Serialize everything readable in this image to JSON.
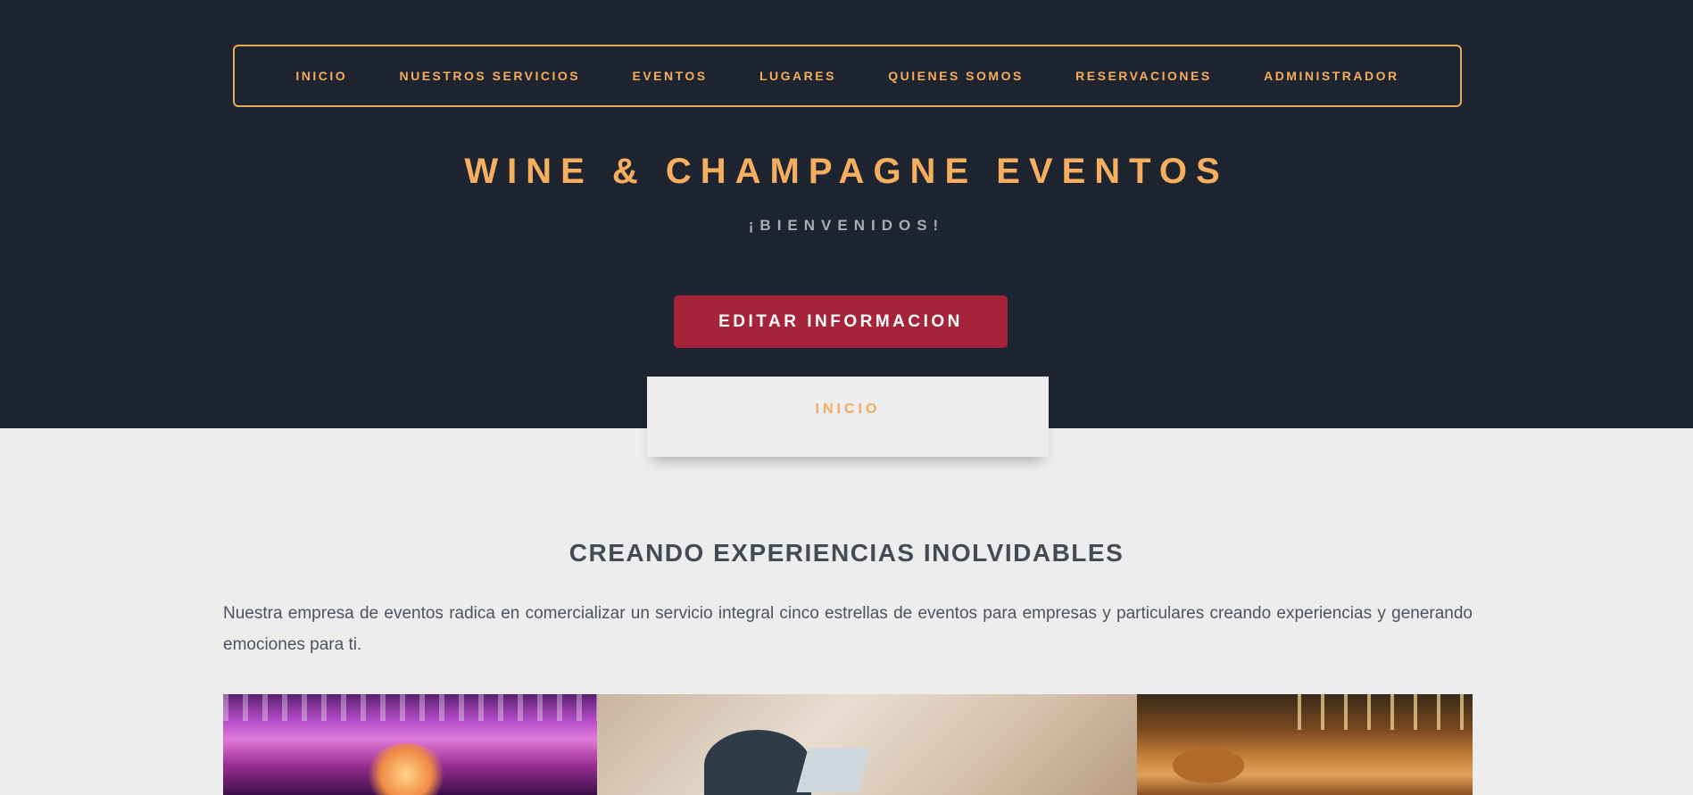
{
  "nav": {
    "items": [
      {
        "label": "INICIO"
      },
      {
        "label": "NUESTROS SERVICIOS"
      },
      {
        "label": "EVENTOS"
      },
      {
        "label": "LUGARES"
      },
      {
        "label": "QUIENES SOMOS"
      },
      {
        "label": "RESERVACIONES"
      },
      {
        "label": "ADMINISTRADOR"
      }
    ]
  },
  "hero": {
    "title": "WINE & CHAMPAGNE EVENTOS",
    "welcome": "¡BIENVENIDOS!",
    "edit_button_label": "EDITAR INFORMACION"
  },
  "tab": {
    "label": "INICIO"
  },
  "main": {
    "heading": "CREANDO EXPERIENCIAS INOLVIDABLES",
    "paragraph": "Nuestra empresa de eventos radica en comercializar un servicio integral cinco estrellas de eventos para empresas y particulares creando experiencias y generando emociones para ti."
  },
  "colors": {
    "hero_background": "#1e2430",
    "accent": "#f5ad5b",
    "button": "#a5243a",
    "page_background": "#ededed",
    "heading_text": "#454b55"
  }
}
